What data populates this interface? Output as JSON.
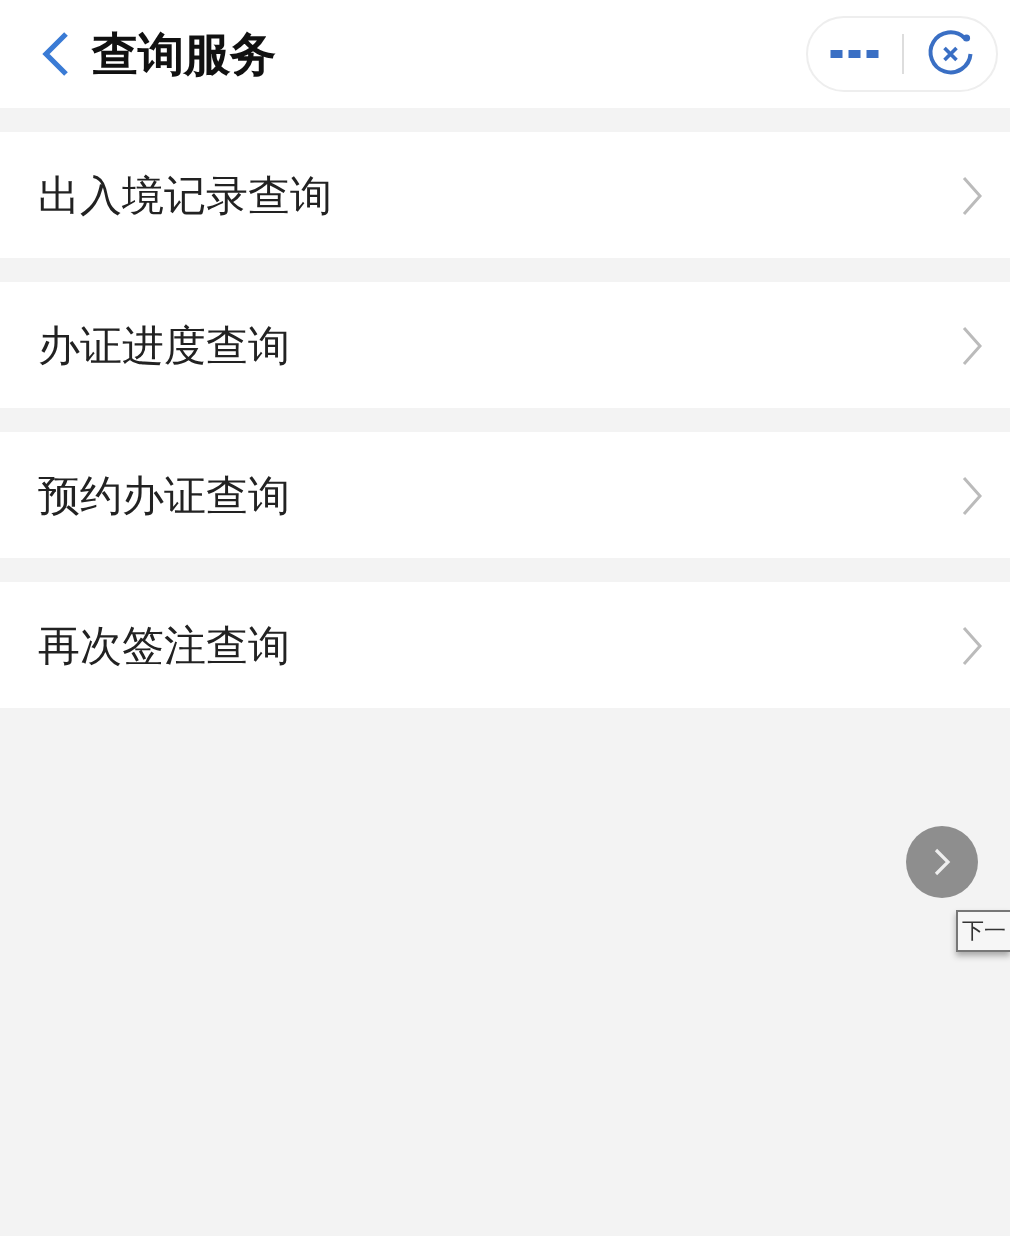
{
  "header": {
    "title": "查询服务"
  },
  "items": [
    {
      "label": "出入境记录查询"
    },
    {
      "label": "办证进度查询"
    },
    {
      "label": "预约办证查询"
    },
    {
      "label": "再次签注查询"
    }
  ],
  "overlay": {
    "tooltip": "下一"
  }
}
